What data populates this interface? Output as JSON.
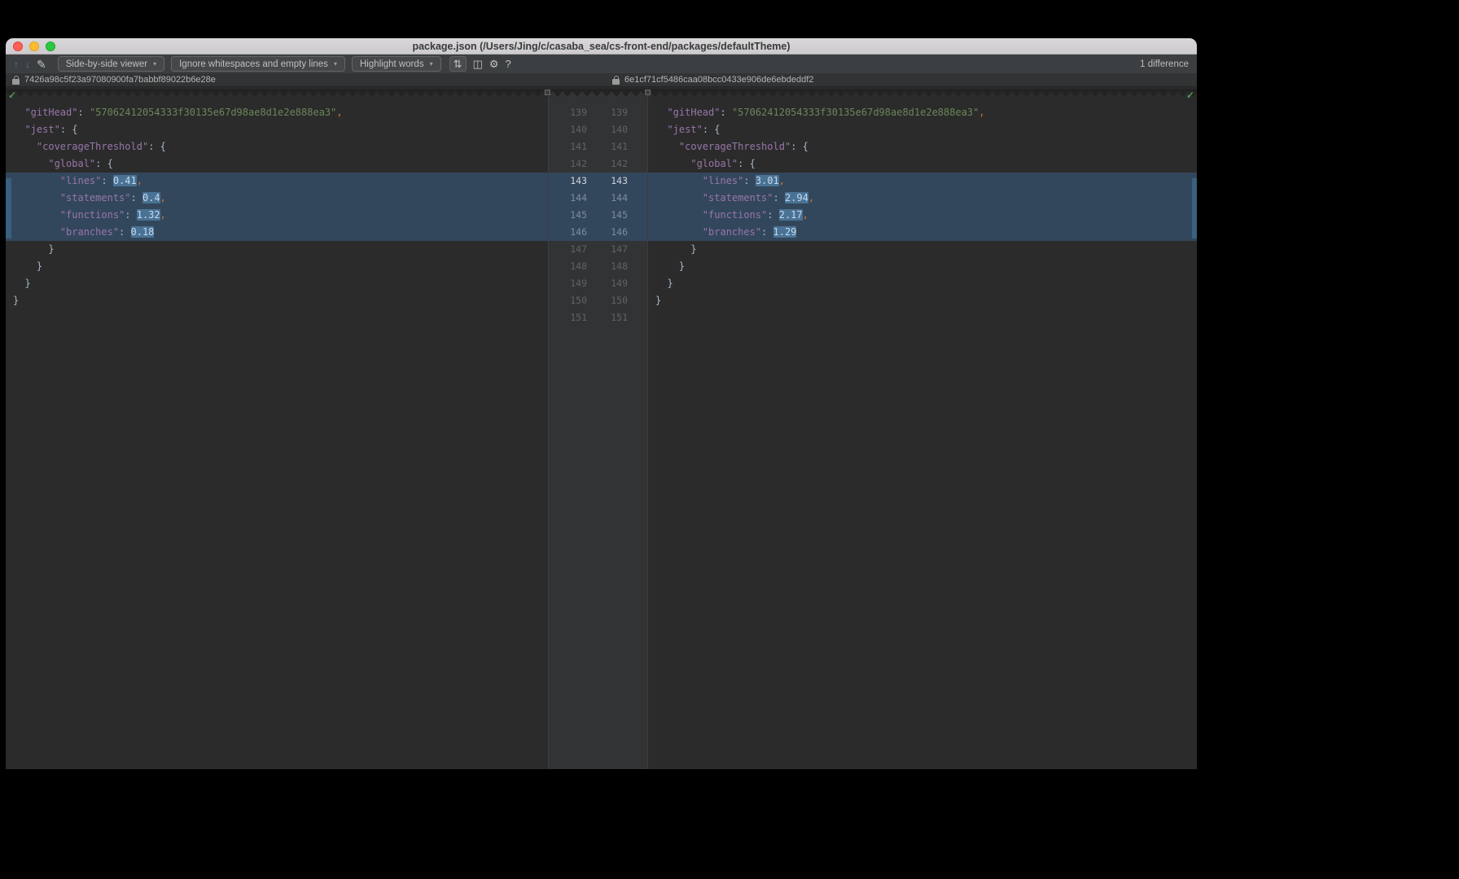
{
  "window": {
    "title": "package.json (/Users/Jing/c/casaba_sea/cs-front-end/packages/defaultTheme)"
  },
  "toolbar": {
    "icons": {
      "previous": "↑",
      "next": "↓",
      "edit": "✎",
      "collapse": "⇅",
      "panes": "◫",
      "settings": "⚙",
      "help": "?"
    },
    "caret_icon": "▾",
    "viewer_dropdown": "Side-by-side viewer",
    "whitespace_dropdown": "Ignore whitespaces and empty lines",
    "highlight_dropdown": "Highlight words",
    "difference_count": "1 difference"
  },
  "revisions": {
    "left_hash": "7426a98c5f23a97080900fa7babbf89022b6e28e",
    "right_hash": "6e1cf71cf5486caa08bcc0433e906de6ebdeddf2"
  },
  "diff": {
    "line_start": 139,
    "line_end": 151,
    "current_line": 143,
    "changed_lines": [
      143,
      144,
      145,
      146
    ],
    "left_lines": [
      {
        "n": 139,
        "t": [
          [
            "p",
            "  "
          ],
          [
            "k",
            "\"gitHead\""
          ],
          [
            "p",
            ": "
          ],
          [
            "s",
            "\"57062412054333f30135e67d98ae8d1e2e888ea3\""
          ],
          [
            "c",
            ","
          ]
        ]
      },
      {
        "n": 140,
        "t": [
          [
            "p",
            "  "
          ],
          [
            "k",
            "\"jest\""
          ],
          [
            "p",
            ": {"
          ]
        ]
      },
      {
        "n": 141,
        "t": [
          [
            "p",
            "    "
          ],
          [
            "k",
            "\"coverageThreshold\""
          ],
          [
            "p",
            ": {"
          ]
        ]
      },
      {
        "n": 142,
        "t": [
          [
            "p",
            "      "
          ],
          [
            "k",
            "\"global\""
          ],
          [
            "p",
            ": {"
          ]
        ]
      },
      {
        "n": 143,
        "t": [
          [
            "p",
            "        "
          ],
          [
            "k",
            "\"lines\""
          ],
          [
            "p",
            ": "
          ],
          [
            "nh",
            "0.41"
          ],
          [
            "c",
            ","
          ]
        ]
      },
      {
        "n": 144,
        "t": [
          [
            "p",
            "        "
          ],
          [
            "k",
            "\"statements\""
          ],
          [
            "p",
            ": "
          ],
          [
            "nh",
            "0.4"
          ],
          [
            "c",
            ","
          ]
        ]
      },
      {
        "n": 145,
        "t": [
          [
            "p",
            "        "
          ],
          [
            "k",
            "\"functions\""
          ],
          [
            "p",
            ": "
          ],
          [
            "nh",
            "1.32"
          ],
          [
            "c",
            ","
          ]
        ]
      },
      {
        "n": 146,
        "t": [
          [
            "p",
            "        "
          ],
          [
            "k",
            "\"branches\""
          ],
          [
            "p",
            ": "
          ],
          [
            "nh",
            "0.18"
          ]
        ]
      },
      {
        "n": 147,
        "t": [
          [
            "p",
            "      }"
          ]
        ]
      },
      {
        "n": 148,
        "t": [
          [
            "p",
            "    }"
          ]
        ]
      },
      {
        "n": 149,
        "t": [
          [
            "p",
            "  }"
          ]
        ]
      },
      {
        "n": 150,
        "t": [
          [
            "p",
            "}"
          ]
        ]
      },
      {
        "n": 151,
        "t": []
      }
    ],
    "right_lines": [
      {
        "n": 139,
        "t": [
          [
            "p",
            "  "
          ],
          [
            "k",
            "\"gitHead\""
          ],
          [
            "p",
            ": "
          ],
          [
            "s",
            "\"57062412054333f30135e67d98ae8d1e2e888ea3\""
          ],
          [
            "c",
            ","
          ]
        ]
      },
      {
        "n": 140,
        "t": [
          [
            "p",
            "  "
          ],
          [
            "k",
            "\"jest\""
          ],
          [
            "p",
            ": {"
          ]
        ]
      },
      {
        "n": 141,
        "t": [
          [
            "p",
            "    "
          ],
          [
            "k",
            "\"coverageThreshold\""
          ],
          [
            "p",
            ": {"
          ]
        ]
      },
      {
        "n": 142,
        "t": [
          [
            "p",
            "      "
          ],
          [
            "k",
            "\"global\""
          ],
          [
            "p",
            ": {"
          ]
        ]
      },
      {
        "n": 143,
        "t": [
          [
            "p",
            "        "
          ],
          [
            "k",
            "\"lines\""
          ],
          [
            "p",
            ": "
          ],
          [
            "nh",
            "3.01"
          ],
          [
            "c",
            ","
          ]
        ]
      },
      {
        "n": 144,
        "t": [
          [
            "p",
            "        "
          ],
          [
            "k",
            "\"statements\""
          ],
          [
            "p",
            ": "
          ],
          [
            "nh",
            "2.94"
          ],
          [
            "c",
            ","
          ]
        ]
      },
      {
        "n": 145,
        "t": [
          [
            "p",
            "        "
          ],
          [
            "k",
            "\"functions\""
          ],
          [
            "p",
            ": "
          ],
          [
            "nh",
            "2.17"
          ],
          [
            "c",
            ","
          ]
        ]
      },
      {
        "n": 146,
        "t": [
          [
            "p",
            "        "
          ],
          [
            "k",
            "\"branches\""
          ],
          [
            "p",
            ": "
          ],
          [
            "nh",
            "1.29"
          ]
        ]
      },
      {
        "n": 147,
        "t": [
          [
            "p",
            "      }"
          ]
        ]
      },
      {
        "n": 148,
        "t": [
          [
            "p",
            "    }"
          ]
        ]
      },
      {
        "n": 149,
        "t": [
          [
            "p",
            "  }"
          ]
        ]
      },
      {
        "n": 150,
        "t": [
          [
            "p",
            "}"
          ]
        ]
      },
      {
        "n": 151,
        "t": []
      }
    ]
  },
  "colors": {
    "editor_bg": "#2b2b2b",
    "gutter_bg": "#313335",
    "toolbar_bg": "#3c3f41",
    "diff_row_bg": "#33475c",
    "diff_word_bg": "#4a7294",
    "key": "#9876aa",
    "string": "#6a8759",
    "number": "#6897bb",
    "punct": "#a9b7c6",
    "comma": "#cc7832",
    "line_number": "#606366",
    "stripe": "#38607f",
    "check_green": "#4f9e58"
  }
}
